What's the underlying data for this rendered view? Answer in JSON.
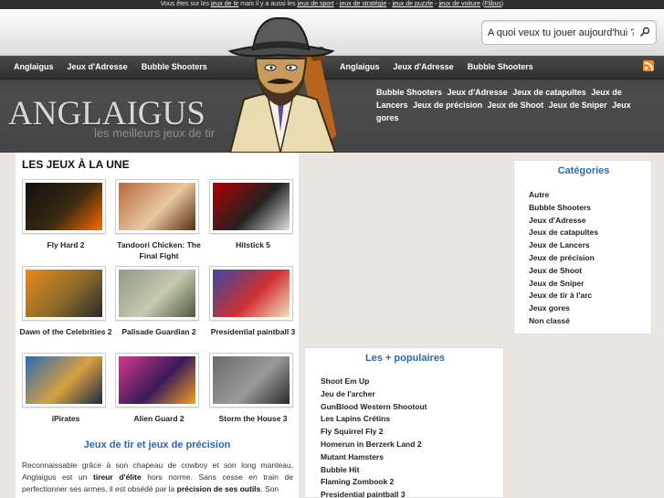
{
  "topstrip": {
    "prefix": "Vous êtes sur les",
    "link1": "jeux de tir",
    "mid": "mais il y a aussi les",
    "link2": "jeux de sport",
    "link3": "jeux de stratégie",
    "link4": "jeux de puzzle",
    "link5": "jeux de voiture",
    "paren_open": "(",
    "credit": "Flibus",
    "paren_close": ")",
    "sep": " - "
  },
  "search": {
    "placeholder": "A quoi veux tu jouer aujourd'hui ?",
    "button_glyph": "⚲"
  },
  "nav_left": [
    "Anglaigus",
    "Jeux d'Adresse",
    "Bubble Shooters"
  ],
  "nav_right": [
    "Anglaigus",
    "Jeux d'Adresse",
    "Bubble Shooters"
  ],
  "logo": {
    "title": "ANGLAIGUS",
    "tagline": "les meilleurs jeux de tir"
  },
  "header_categories": [
    "Bubble Shooters",
    "Jeux d'Adresse",
    "Jeux de catapultes",
    "Jeux de Lancers",
    "Jeux de précision",
    "Jeux de Shoot",
    "Jeux de Sniper",
    "Jeux gores"
  ],
  "featured": {
    "title": "LES JEUX À LA UNE",
    "games": [
      {
        "name": "Fly Hard 2",
        "colors": [
          "#111",
          "#3b2a10",
          "#ff6a00"
        ]
      },
      {
        "name": "Tandoori Chicken: The Final Fight",
        "colors": [
          "#b56a3a",
          "#e9c7a0",
          "#5a2d12"
        ]
      },
      {
        "name": "Hitstick 5",
        "colors": [
          "#b00000",
          "#222",
          "#e0e0e0"
        ]
      },
      {
        "name": "Dawn of the Celebrities 2",
        "colors": [
          "#e98a1e",
          "#8a6a2a",
          "#2a2a2a"
        ]
      },
      {
        "name": "Palisade Guardian 2",
        "colors": [
          "#8e9a84",
          "#c8c8b0",
          "#4a5a40"
        ]
      },
      {
        "name": "Presidential paintball 3",
        "colors": [
          "#3a4aa0",
          "#d03030",
          "#f0e0c0"
        ]
      },
      {
        "name": "iPirates",
        "colors": [
          "#2c6ab0",
          "#d8a040",
          "#1a2a4a"
        ]
      },
      {
        "name": "Alien Guard 2",
        "colors": [
          "#d03a8a",
          "#3a1a5a",
          "#f0a020"
        ]
      },
      {
        "name": "Storm the House 3",
        "colors": [
          "#6a6a6a",
          "#9a9a9a",
          "#2a2a2a"
        ]
      }
    ]
  },
  "article": {
    "title": "Jeux de tir et jeux de précision",
    "p1": "Reconnaissable grâce à son chapeau de cowboy et son long manteau, Anglaigus est un ",
    "b1": "tireur d'élite",
    "p2": " hors norme. Sans cesse en train de perfectionner ses armes, il est obsédé par la ",
    "b2": "précision de ses outils",
    "p3": ". Son"
  },
  "popular": {
    "title": "Les + populaires",
    "items": [
      "Shoot Em Up",
      "Jeu de l'archer",
      "GunBlood Western Shootout",
      "Les Lapins Crétins",
      "Fly Squirrel Fly 2",
      "Homerun in Berzerk Land 2",
      "Mutant Hamsters",
      "Bubble Hit",
      "Flaming Zombook 2",
      "Presidential paintball 3"
    ]
  },
  "categories": {
    "title": "Catégories",
    "items": [
      "Autre",
      "Bubble Shooters",
      "Jeux d'Adresse",
      "Jeux de catapultes",
      "Jeux de Lancers",
      "Jeux de précision",
      "Jeux de Shoot",
      "Jeux de Sniper",
      "Jeux de tir à l'arc",
      "Jeux gores",
      "Non classé"
    ]
  },
  "colors": {
    "accent": "#2e6aa8",
    "header": "#3f3f3f",
    "rss": "#f58a1f"
  }
}
